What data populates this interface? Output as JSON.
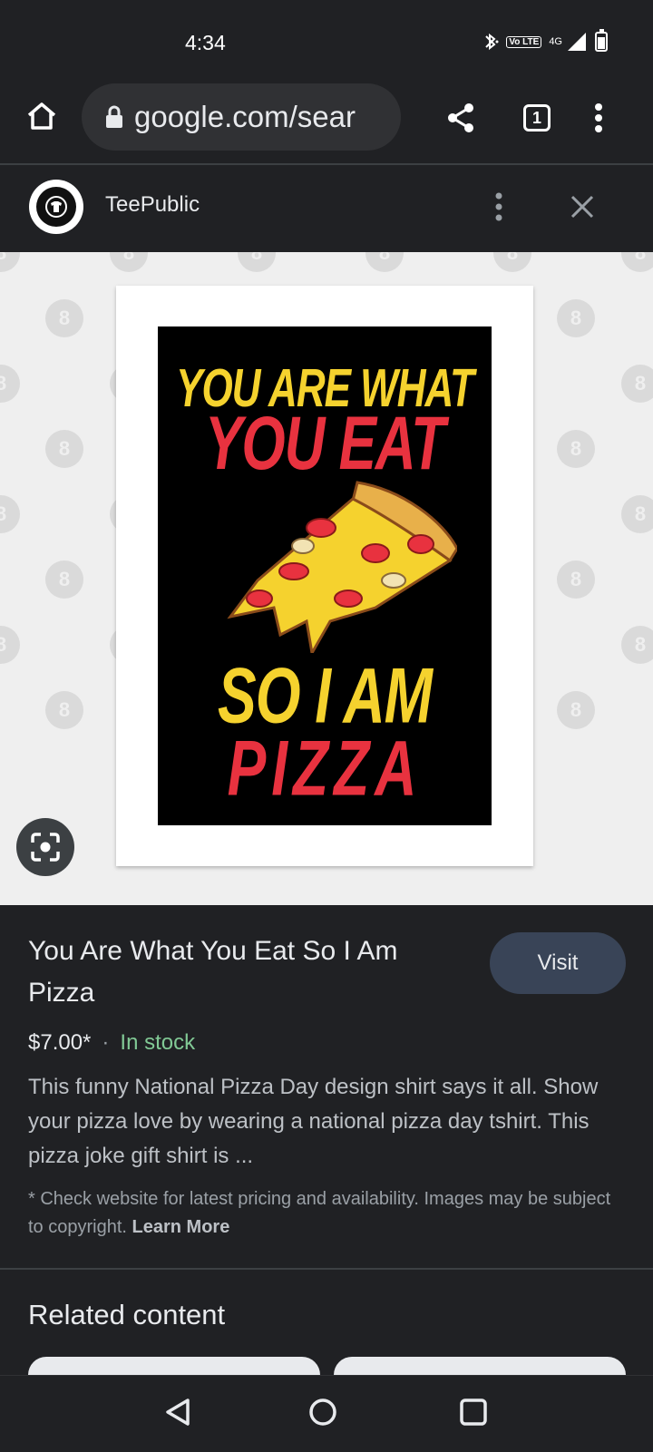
{
  "status_bar": {
    "time": "4:34",
    "network_badge": "Vo LTE",
    "signal_label": "4G"
  },
  "browser": {
    "home_icon": "home-icon",
    "lock_icon": "lock-icon",
    "url": "google.com/sear",
    "share_icon": "share-icon",
    "tab_count": "1",
    "menu_icon": "more-vert-icon"
  },
  "site": {
    "name": "TeePublic",
    "menu_icon": "more-vert-icon",
    "close_icon": "close-icon"
  },
  "poster": {
    "line1": "YOU ARE WHAT",
    "line2": "YOU EAT",
    "line3": "SO I AM",
    "line4": "PIZZA",
    "yellow": "#f5d22e",
    "red": "#e8323f"
  },
  "lens_icon": "google-lens-icon",
  "product": {
    "title": "You Are What You Eat So I Am Pizza",
    "visit_label": "Visit",
    "price": "$7.00*",
    "separator": "·",
    "stock": "In stock",
    "description": "This funny National Pizza Day design shirt says it all. Show your pizza love by wearing a national pizza day tshirt. This pizza joke gift shirt is ...",
    "disclaimer": "* Check website for latest pricing and availability. Images may be subject to copyright.",
    "learn_more": "Learn More"
  },
  "related": {
    "title": "Related content"
  },
  "nav": {
    "back_icon": "back-triangle-icon",
    "home_icon": "home-circle-icon",
    "recents_icon": "recents-square-icon"
  },
  "colors": {
    "background": "#202124",
    "stock_green": "#81c995",
    "visit_button": "#394457"
  }
}
